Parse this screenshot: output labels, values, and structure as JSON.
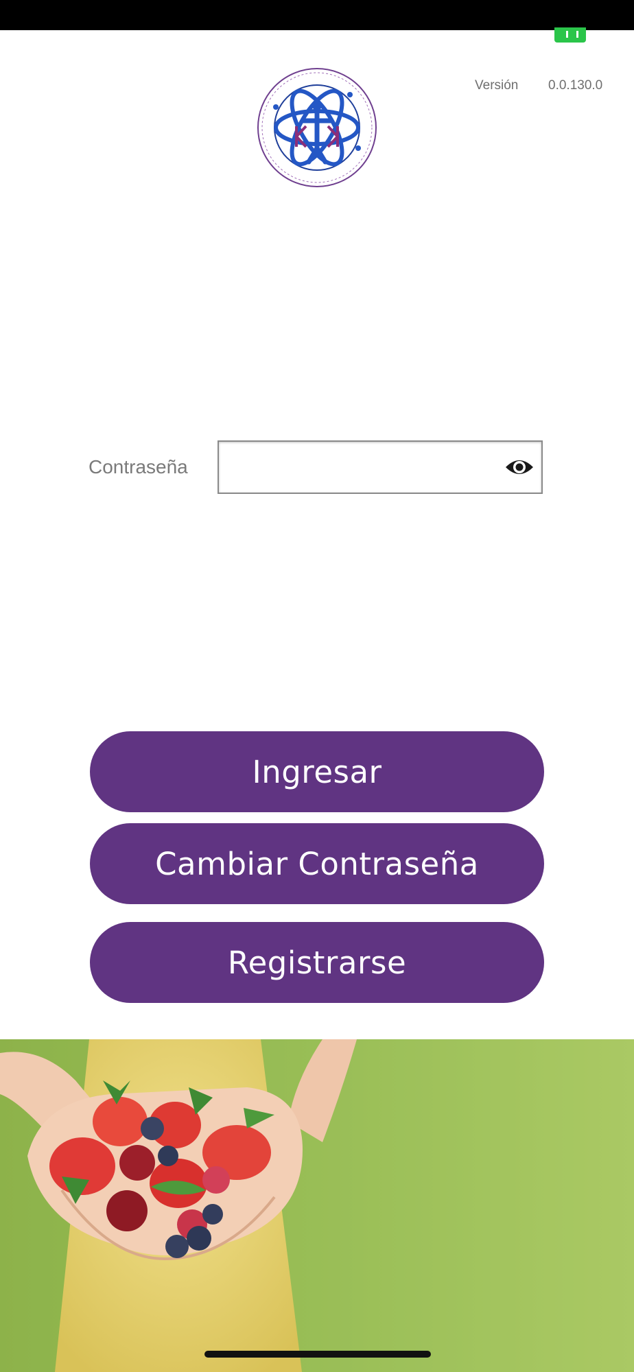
{
  "status_bar": {
    "battery_icon": "battery-charging-icon",
    "battery_color": "#2bc54a"
  },
  "header": {
    "logo_icon": "clinic-atom-logo",
    "version_label": "Versión",
    "version_value": "0.0.130.0"
  },
  "login": {
    "password_label": "Contraseña",
    "password_value": "",
    "password_placeholder": "",
    "toggle_visibility_icon": "eye-icon"
  },
  "actions": {
    "login_label": "Ingresar",
    "change_password_label": "Cambiar Contraseña",
    "register_label": "Registrarse",
    "button_color": "#603482"
  },
  "hero": {
    "image_subject": "hands-holding-berries"
  }
}
